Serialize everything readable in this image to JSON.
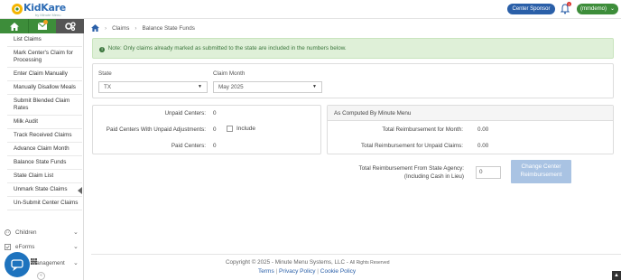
{
  "brand": {
    "name": "KidKare",
    "tagline": "by Minute Menu"
  },
  "header": {
    "sponsor_label": "Center Sponsor",
    "user_label": "(mmdemo)",
    "notification_count": "1"
  },
  "sidebar": {
    "items": [
      {
        "label": "List Claims"
      },
      {
        "label": "Mark Center's Claim for Processing"
      },
      {
        "label": "Enter Claim Manually"
      },
      {
        "label": "Manually Disallow Meals"
      },
      {
        "label": "Submit Blended Claim Rates"
      },
      {
        "label": "Milk Audit"
      },
      {
        "label": "Track Received Claims"
      },
      {
        "label": "Advance Claim Month"
      },
      {
        "label": "Balance State Funds"
      },
      {
        "label": "State Claim List"
      },
      {
        "label": "Unmark State Claims"
      },
      {
        "label": "Un-Submit Center Claims"
      }
    ],
    "groups": [
      {
        "label": "Children"
      },
      {
        "label": "eForms"
      },
      {
        "label": "Management"
      }
    ]
  },
  "breadcrumb": {
    "home_icon": "home-icon",
    "level1": "Claims",
    "level2": "Balance State Funds"
  },
  "note": {
    "text": "Note: Only claims already marked as submitted to the state are included in the numbers below."
  },
  "filters": {
    "state_label": "State",
    "state_value": "TX",
    "month_label": "Claim Month",
    "month_value": "May 2025"
  },
  "summary": {
    "unpaid_centers_label": "Unpaid Centers:",
    "unpaid_centers_value": "0",
    "paid_unpaid_adj_label": "Paid Centers With Unpaid Adjustments:",
    "paid_unpaid_adj_value": "0",
    "include_label": "Include",
    "paid_centers_label": "Paid Centers:",
    "paid_centers_value": "0"
  },
  "computed": {
    "heading": "As Computed By Minute Menu",
    "total_month_label": "Total Reimbursement for Month:",
    "total_month_value": "0.00",
    "total_unpaid_label": "Total Reimbursement for Unpaid Claims:",
    "total_unpaid_value": "0.00"
  },
  "agency": {
    "label_line1": "Total Reimbursement From State Agency:",
    "label_line2": "(Including Cash in Lieu)",
    "input_value": "0",
    "button_line1": "Change Center",
    "button_line2": "Reimbursement"
  },
  "footer": {
    "copyright": "Copyright © 2025 - Minute Menu Systems, LLC -",
    "rights": "All Rights Reserved",
    "terms": "Terms",
    "privacy": "Privacy Policy",
    "cookie": "Cookie Policy"
  },
  "colors": {
    "brand_green": "#3d8d3a",
    "brand_blue": "#2a5fa8",
    "note_bg": "#dff0d8"
  }
}
